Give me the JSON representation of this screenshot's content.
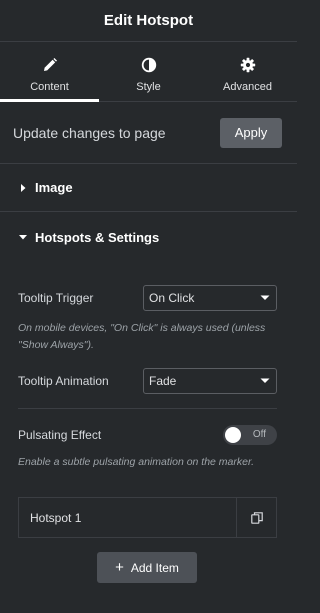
{
  "header": {
    "title": "Edit Hotspot"
  },
  "tabs": [
    {
      "label": "Content",
      "icon": "pencil-icon",
      "active": true
    },
    {
      "label": "Style",
      "icon": "half-circle-icon",
      "active": false
    },
    {
      "label": "Advanced",
      "icon": "gear-icon",
      "active": false
    }
  ],
  "update": {
    "text": "Update changes to page",
    "apply_label": "Apply"
  },
  "sections": {
    "image": {
      "label": "Image",
      "expanded": false
    },
    "hotspots": {
      "label": "Hotspots & Settings",
      "expanded": true
    }
  },
  "controls": {
    "tooltip_trigger": {
      "label": "Tooltip Trigger",
      "value": "On Click",
      "help": "On mobile devices, \"On Click\" is always used (unless \"Show Always\")."
    },
    "tooltip_animation": {
      "label": "Tooltip Animation",
      "value": "Fade"
    },
    "pulsating": {
      "label": "Pulsating Effect",
      "state_text": "Off",
      "help": "Enable a subtle pulsating animation on the marker."
    }
  },
  "repeater": {
    "items": [
      {
        "title": "Hotspot 1"
      }
    ],
    "add_label": "Add Item"
  },
  "colors": {
    "panel_bg": "#26292c",
    "border": "#3b3e43",
    "apply_btn": "#5c6066",
    "add_btn": "#4d5157"
  }
}
